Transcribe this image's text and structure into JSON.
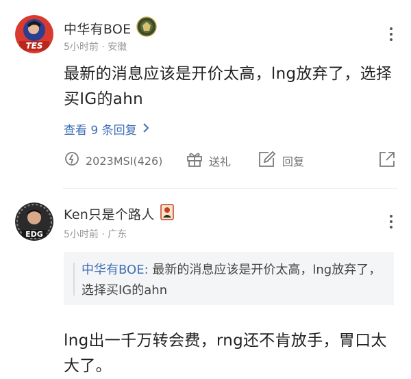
{
  "comments": [
    {
      "username": "中华有BOE",
      "meta": "5小时前 · 安徽",
      "content": "最新的消息应该是开价太高，lng放弃了，选择买IG的ahn",
      "view_replies": "查看 9 条回复",
      "avatar_badge": "TES",
      "tag": "2023MSI(426)",
      "gift": "送礼",
      "reply": "回复",
      "icons": [
        "tag-icon",
        "gift-icon",
        "edit-icon",
        "share-icon",
        "more-icon",
        "medal-icon"
      ]
    },
    {
      "username": "Ken只是个路人",
      "meta": "5小时前 · 广东",
      "avatar_badge": "EDG",
      "quote_author": "中华有BOE:",
      "quote_text": " 最新的消息应该是开价太高，lng放弃了，选择买IG的ahn",
      "content": "lng出一千万转会费，rng还不肯放手，胃口太大了。",
      "icons": [
        "more-icon",
        "card-icon"
      ]
    }
  ],
  "colors": {
    "link": "#3e6fb5",
    "meta": "#999999",
    "text": "#222222",
    "quote_bg": "#f4f5f7"
  }
}
